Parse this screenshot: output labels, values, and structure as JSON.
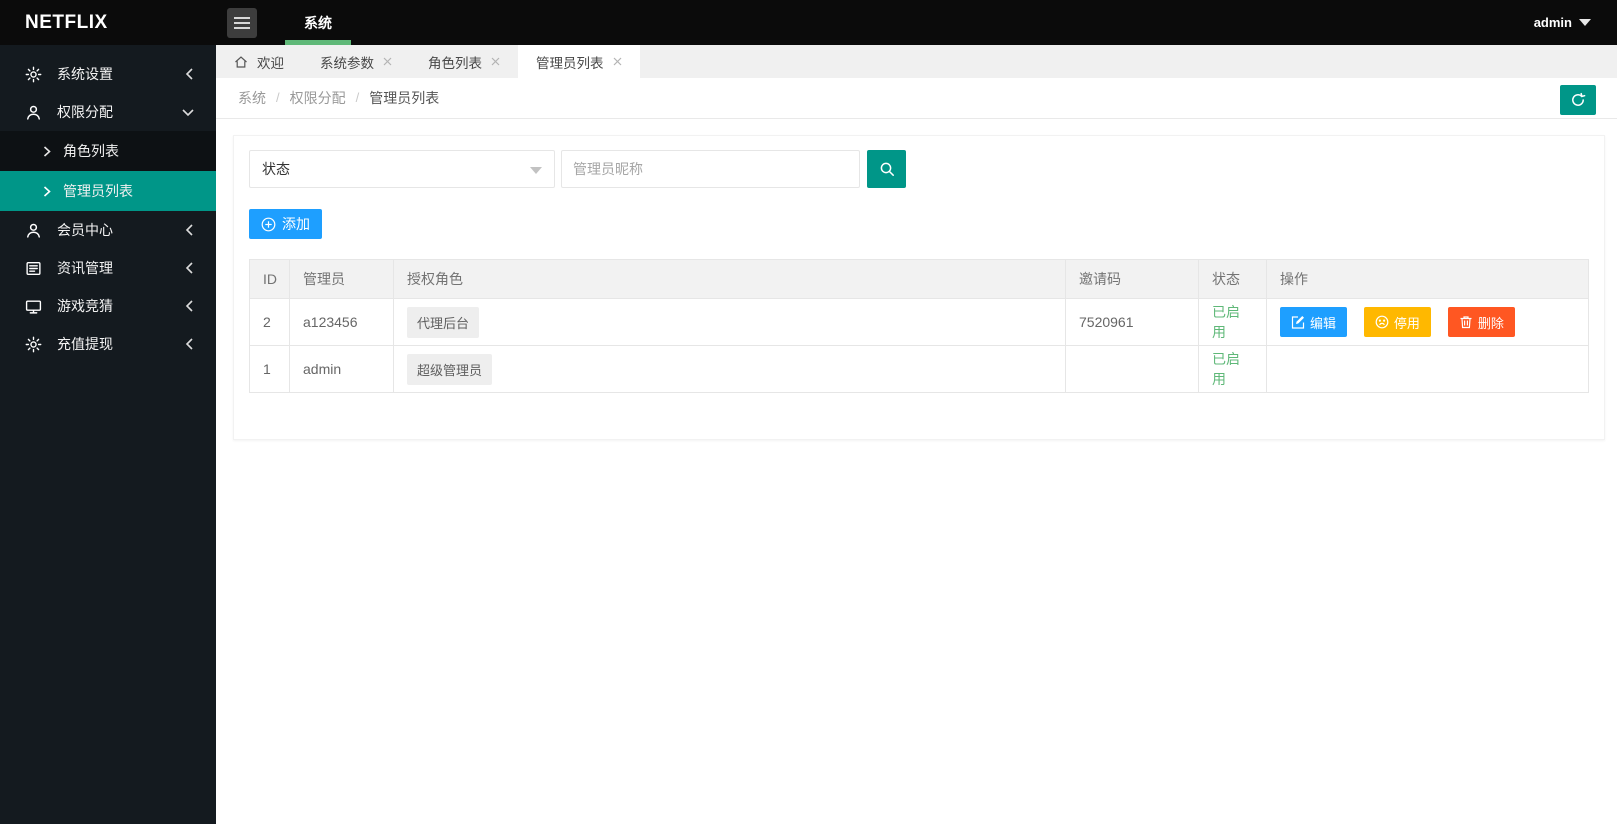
{
  "topbar": {
    "logo": "NETFLIX",
    "nav_item": "系统",
    "user": "admin"
  },
  "sidebar": {
    "items": [
      {
        "label": "系统设置",
        "icon": "gear-icon",
        "state": "collapsed"
      },
      {
        "label": "权限分配",
        "icon": "user-icon",
        "state": "expanded"
      },
      {
        "label": "会员中心",
        "icon": "member-icon",
        "state": "collapsed"
      },
      {
        "label": "资讯管理",
        "icon": "news-icon",
        "state": "collapsed"
      },
      {
        "label": "游戏竞猜",
        "icon": "monitor-icon",
        "state": "collapsed"
      },
      {
        "label": "充值提现",
        "icon": "gear-icon",
        "state": "collapsed"
      }
    ],
    "submenu": [
      {
        "label": "角色列表",
        "active": false
      },
      {
        "label": "管理员列表",
        "active": true
      }
    ]
  },
  "tabs": [
    {
      "label": "欢迎",
      "icon": "home-icon",
      "closable": false,
      "active": false
    },
    {
      "label": "系统参数",
      "closable": true,
      "active": false
    },
    {
      "label": "角色列表",
      "closable": true,
      "active": false
    },
    {
      "label": "管理员列表",
      "closable": true,
      "active": true
    }
  ],
  "breadcrumb": {
    "items": [
      "系统",
      "权限分配",
      "管理员列表"
    ]
  },
  "filter": {
    "status_label": "状态",
    "nickname_placeholder": "管理员昵称"
  },
  "toolbar": {
    "add_label": "添加"
  },
  "table": {
    "headers": [
      "ID",
      "管理员",
      "授权角色",
      "邀请码",
      "状态",
      "操作"
    ],
    "rows": [
      {
        "id": "2",
        "admin": "a123456",
        "role": "代理后台",
        "invite_code": "7520961",
        "status": "已启用",
        "actions": {
          "edit": "编辑",
          "disable": "停用",
          "delete": "删除"
        }
      },
      {
        "id": "1",
        "admin": "admin",
        "role": "超级管理员",
        "invite_code": "",
        "status": "已启用"
      }
    ]
  },
  "colors": {
    "accent_teal": "#009688",
    "primary_blue": "#1E9FFF",
    "warning_orange": "#FFB800",
    "danger_red": "#FF5722",
    "success_green": "#5FB878",
    "topbar_black": "#0b0b0b",
    "sidebar_dark": "#141a1f"
  }
}
